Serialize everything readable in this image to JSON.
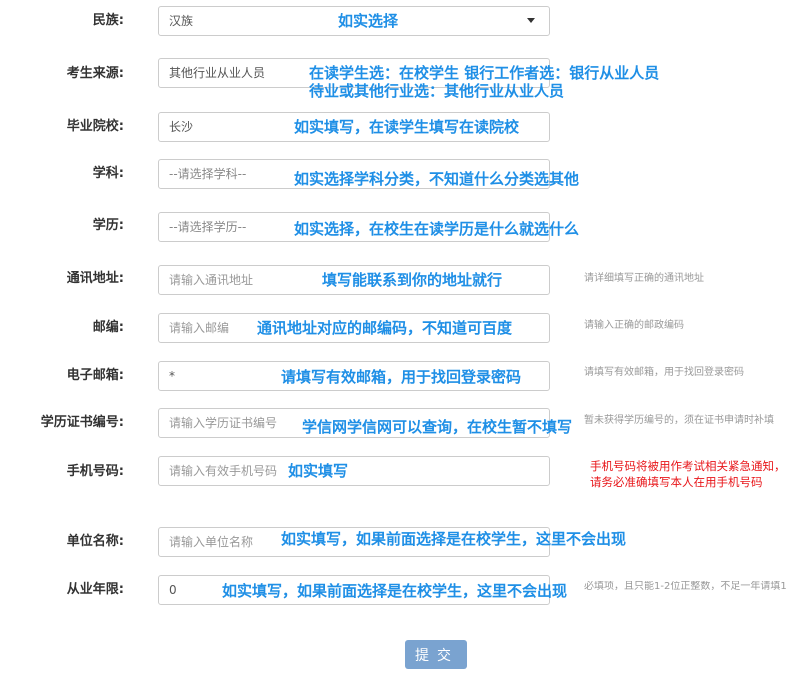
{
  "form": {
    "ethnicity": {
      "label": "民族:",
      "value": "汉族",
      "note": "如实选择"
    },
    "source": {
      "label": "考生来源:",
      "value": "其他行业从业人员",
      "note_line1": "在读学生选：在校学生 银行工作者选：银行从业人员",
      "note_line2": "待业或其他行业选：其他行业从业人员"
    },
    "school": {
      "label": "毕业院校:",
      "value": "长沙",
      "note": "如实填写，在读学生填写在读院校"
    },
    "subject": {
      "label": "学科:",
      "placeholder": "--请选择学科--",
      "note": "如实选择学科分类，不知道什么分类选其他"
    },
    "education": {
      "label": "学历:",
      "placeholder": "--请选择学历--",
      "note": "如实选择，在校生在读学历是什么就选什么"
    },
    "address": {
      "label": "通讯地址:",
      "placeholder": "请输入通讯地址",
      "note": "填写能联系到你的地址就行",
      "hint": "请详细填写正确的通讯地址"
    },
    "postcode": {
      "label": "邮编:",
      "placeholder": "请输入邮编",
      "note": "通讯地址对应的邮编码，不知道可百度",
      "hint": "请输入正确的邮政编码"
    },
    "email": {
      "label": "电子邮箱:",
      "value": "*",
      "note": "请填写有效邮箱，用于找回登录密码",
      "hint": "请填写有效邮箱，用于找回登录密码"
    },
    "certificate": {
      "label": "学历证书编号:",
      "placeholder": "请输入学历证书编号",
      "note": "学信网学信网可以查询，在校生暂不填写",
      "hint": "暂未获得学历编号的，须在证书申请时补填"
    },
    "phone": {
      "label": "手机号码:",
      "placeholder": "请输入有效手机号码",
      "note": "如实填写",
      "hint": "手机号码将被用作考试相关紧急通知，请务必准确填写本人在用手机号码"
    },
    "company": {
      "label": "单位名称:",
      "placeholder": "请输入单位名称",
      "note": "如实填写，如果前面选择是在校学生，这里不会出现"
    },
    "years": {
      "label": "从业年限:",
      "value": "0",
      "note": "如实填写，如果前面选择是在校学生，这里不会出现",
      "hint": "必填项，且只能1-2位正整数，不足一年请填1"
    },
    "submit_label": "提交"
  },
  "colors": {
    "annotation": "#1f8fe6",
    "warning": "#e8161a",
    "submit_bg": "#7aa3d0"
  }
}
